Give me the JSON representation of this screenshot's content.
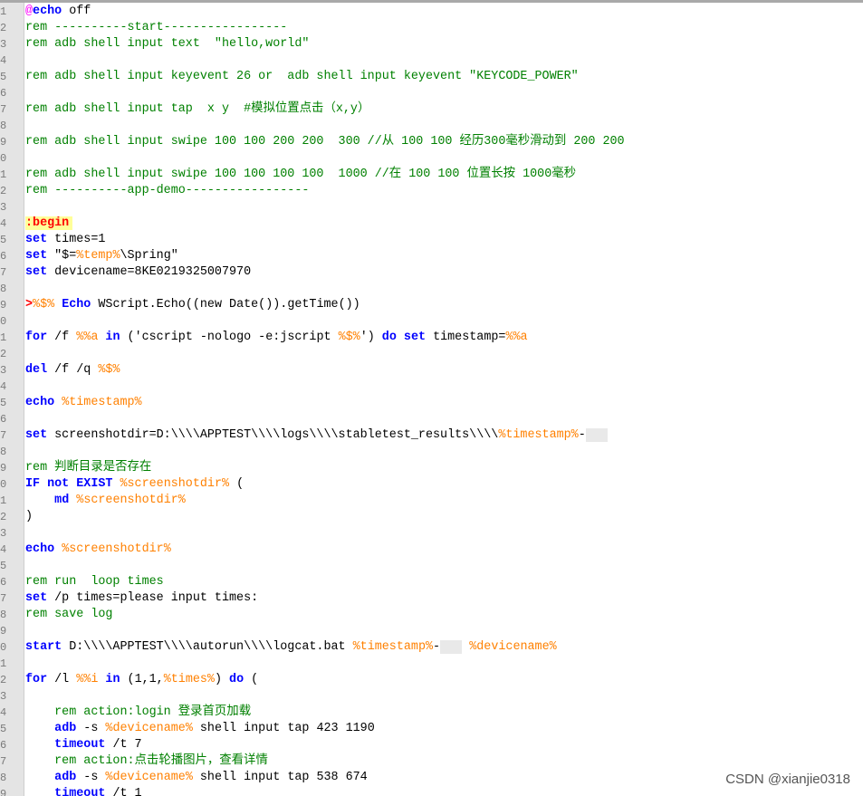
{
  "editor": {
    "lines": [
      {
        "n": "1",
        "tokens": [
          {
            "t": "@",
            "c": "at"
          },
          {
            "t": "echo",
            "c": "kw"
          },
          {
            "t": " off",
            "c": "plain"
          }
        ]
      },
      {
        "n": "2",
        "tokens": [
          {
            "t": "rem ----------start-----------------",
            "c": "cm"
          }
        ]
      },
      {
        "n": "3",
        "tokens": [
          {
            "t": "rem adb shell input text  \"hello,world\"",
            "c": "cm"
          }
        ]
      },
      {
        "n": "4",
        "tokens": []
      },
      {
        "n": "5",
        "tokens": [
          {
            "t": "rem adb shell input keyevent 26 or  adb shell input keyevent \"KEYCODE_POWER\"",
            "c": "cm"
          }
        ]
      },
      {
        "n": "6",
        "tokens": []
      },
      {
        "n": "7",
        "tokens": [
          {
            "t": "rem adb shell input tap  x y  #模拟位置点击（x,y）",
            "c": "cm"
          }
        ]
      },
      {
        "n": "8",
        "tokens": []
      },
      {
        "n": "9",
        "tokens": [
          {
            "t": "rem adb shell input swipe 100 100 200 200  300 //从 100 100 经历300毫秒滑动到 200 200",
            "c": "cm"
          }
        ]
      },
      {
        "n": "0",
        "tokens": []
      },
      {
        "n": "1",
        "tokens": [
          {
            "t": "rem adb shell input swipe 100 100 100 100  1000 //在 100 100 位置长按 1000毫秒",
            "c": "cm"
          }
        ]
      },
      {
        "n": "2",
        "tokens": [
          {
            "t": "rem ----------app-demo-----------------",
            "c": "cm"
          }
        ]
      },
      {
        "n": "3",
        "tokens": []
      },
      {
        "n": "4",
        "tokens": [
          {
            "t": ":begin",
            "c": "lbl"
          }
        ]
      },
      {
        "n": "5",
        "tokens": [
          {
            "t": "set",
            "c": "kw"
          },
          {
            "t": " times=1",
            "c": "plain"
          }
        ]
      },
      {
        "n": "6",
        "tokens": [
          {
            "t": "set",
            "c": "kw"
          },
          {
            "t": " \"$=",
            "c": "plain"
          },
          {
            "t": "%temp%",
            "c": "var"
          },
          {
            "t": "\\Spring\"",
            "c": "plain"
          }
        ]
      },
      {
        "n": "7",
        "tokens": [
          {
            "t": "set",
            "c": "kw"
          },
          {
            "t": " devicename=8KE0219325007970",
            "c": "plain"
          }
        ]
      },
      {
        "n": "8",
        "tokens": []
      },
      {
        "n": "9",
        "tokens": [
          {
            "t": ">",
            "c": "red"
          },
          {
            "t": "%$%",
            "c": "var"
          },
          {
            "t": " ",
            "c": "plain"
          },
          {
            "t": "Echo",
            "c": "kw"
          },
          {
            "t": " WScript.Echo((new Date()).getTime())",
            "c": "plain"
          }
        ]
      },
      {
        "n": "0",
        "tokens": []
      },
      {
        "n": "1",
        "tokens": [
          {
            "t": "for",
            "c": "kw"
          },
          {
            "t": " /f ",
            "c": "plain"
          },
          {
            "t": "%%a",
            "c": "var"
          },
          {
            "t": " ",
            "c": "plain"
          },
          {
            "t": "in",
            "c": "kw"
          },
          {
            "t": " ('cscript -nologo -e:jscript ",
            "c": "plain"
          },
          {
            "t": "%$%",
            "c": "var"
          },
          {
            "t": "') ",
            "c": "plain"
          },
          {
            "t": "do",
            "c": "kw"
          },
          {
            "t": " ",
            "c": "plain"
          },
          {
            "t": "set",
            "c": "kw"
          },
          {
            "t": " timestamp=",
            "c": "plain"
          },
          {
            "t": "%%a",
            "c": "var"
          }
        ]
      },
      {
        "n": "2",
        "tokens": []
      },
      {
        "n": "3",
        "tokens": [
          {
            "t": "del",
            "c": "kw"
          },
          {
            "t": " /f /q ",
            "c": "plain"
          },
          {
            "t": "%$%",
            "c": "var"
          }
        ]
      },
      {
        "n": "4",
        "tokens": []
      },
      {
        "n": "5",
        "tokens": [
          {
            "t": "echo",
            "c": "kw"
          },
          {
            "t": " ",
            "c": "plain"
          },
          {
            "t": "%timestamp%",
            "c": "var"
          }
        ]
      },
      {
        "n": "6",
        "tokens": []
      },
      {
        "n": "7",
        "tokens": [
          {
            "t": "set",
            "c": "kw"
          },
          {
            "t": " screenshotdir=D:\\\\\\\\APPTEST\\\\\\\\logs\\\\\\\\stabletest_results\\\\\\\\",
            "c": "plain"
          },
          {
            "t": "%timestamp%",
            "c": "var"
          },
          {
            "t": "-",
            "c": "plain"
          },
          {
            "t": "000",
            "c": "blur"
          }
        ]
      },
      {
        "n": "8",
        "tokens": []
      },
      {
        "n": "9",
        "tokens": [
          {
            "t": "rem 判断目录是否存在",
            "c": "cm"
          }
        ]
      },
      {
        "n": "0",
        "tokens": [
          {
            "t": "IF not EXIST",
            "c": "kw"
          },
          {
            "t": " ",
            "c": "plain"
          },
          {
            "t": "%screenshotdir%",
            "c": "var"
          },
          {
            "t": " (",
            "c": "plain"
          }
        ]
      },
      {
        "n": "1",
        "tokens": [
          {
            "t": "    ",
            "c": "plain"
          },
          {
            "t": "md",
            "c": "kw"
          },
          {
            "t": " ",
            "c": "plain"
          },
          {
            "t": "%screenshotdir%",
            "c": "var"
          }
        ]
      },
      {
        "n": "2",
        "tokens": [
          {
            "t": ")",
            "c": "plain"
          }
        ]
      },
      {
        "n": "3",
        "tokens": []
      },
      {
        "n": "4",
        "tokens": [
          {
            "t": "echo",
            "c": "kw"
          },
          {
            "t": " ",
            "c": "plain"
          },
          {
            "t": "%screenshotdir%",
            "c": "var"
          }
        ]
      },
      {
        "n": "5",
        "tokens": []
      },
      {
        "n": "6",
        "tokens": [
          {
            "t": "rem run  loop times",
            "c": "cm"
          }
        ]
      },
      {
        "n": "7",
        "tokens": [
          {
            "t": "set",
            "c": "kw"
          },
          {
            "t": " /p times=please input times:",
            "c": "plain"
          }
        ]
      },
      {
        "n": "8",
        "tokens": [
          {
            "t": "rem save log",
            "c": "cm"
          }
        ]
      },
      {
        "n": "9",
        "tokens": []
      },
      {
        "n": "0",
        "tokens": [
          {
            "t": "start",
            "c": "kw"
          },
          {
            "t": " D:\\\\\\\\APPTEST\\\\\\\\autorun\\\\\\\\logcat.bat ",
            "c": "plain"
          },
          {
            "t": "%timestamp%",
            "c": "var"
          },
          {
            "t": "-",
            "c": "plain"
          },
          {
            "t": "000",
            "c": "blur"
          },
          {
            "t": " ",
            "c": "plain"
          },
          {
            "t": "%devicename%",
            "c": "var"
          }
        ]
      },
      {
        "n": "1",
        "tokens": []
      },
      {
        "n": "2",
        "tokens": [
          {
            "t": "for",
            "c": "kw"
          },
          {
            "t": " /l ",
            "c": "plain"
          },
          {
            "t": "%%i",
            "c": "var"
          },
          {
            "t": " ",
            "c": "plain"
          },
          {
            "t": "in",
            "c": "kw"
          },
          {
            "t": " (1,1,",
            "c": "plain"
          },
          {
            "t": "%times%",
            "c": "var"
          },
          {
            "t": ") ",
            "c": "plain"
          },
          {
            "t": "do",
            "c": "kw"
          },
          {
            "t": " (",
            "c": "plain"
          }
        ]
      },
      {
        "n": "3",
        "tokens": []
      },
      {
        "n": "4",
        "tokens": [
          {
            "t": "    rem action:login 登录首页加载",
            "c": "cm"
          }
        ]
      },
      {
        "n": "5",
        "tokens": [
          {
            "t": "    ",
            "c": "plain"
          },
          {
            "t": "adb",
            "c": "kw"
          },
          {
            "t": " -s ",
            "c": "plain"
          },
          {
            "t": "%devicename%",
            "c": "var"
          },
          {
            "t": " shell input tap 423 1190",
            "c": "plain"
          }
        ]
      },
      {
        "n": "6",
        "tokens": [
          {
            "t": "    ",
            "c": "plain"
          },
          {
            "t": "timeout",
            "c": "kw"
          },
          {
            "t": " /t 7",
            "c": "plain"
          }
        ]
      },
      {
        "n": "7",
        "tokens": [
          {
            "t": "    rem action:点击轮播图片，查看详情",
            "c": "cm"
          }
        ]
      },
      {
        "n": "8",
        "tokens": [
          {
            "t": "    ",
            "c": "plain"
          },
          {
            "t": "adb",
            "c": "kw"
          },
          {
            "t": " -s ",
            "c": "plain"
          },
          {
            "t": "%devicename%",
            "c": "var"
          },
          {
            "t": " shell input tap 538 674",
            "c": "plain"
          }
        ]
      },
      {
        "n": "9",
        "tokens": [
          {
            "t": "    ",
            "c": "plain"
          },
          {
            "t": "timeout",
            "c": "kw"
          },
          {
            "t": " /t 1",
            "c": "plain"
          }
        ]
      }
    ]
  },
  "watermark": "CSDN @xianjie0318",
  "colors": {
    "keyword": "#0000ff",
    "comment": "#008000",
    "variable": "#ff8000",
    "gutter": "#e4e4e4"
  }
}
